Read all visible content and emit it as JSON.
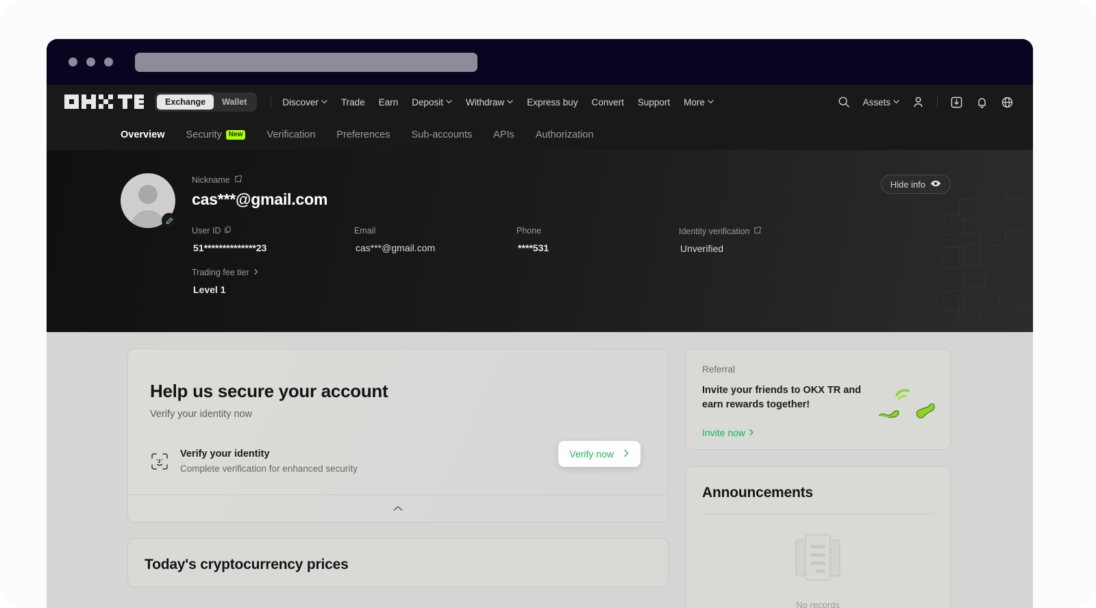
{
  "browser": {
    "address_bar_placeholder": "",
    "traffic_lights": [
      "close-dot",
      "minimize-dot",
      "maximize-dot"
    ]
  },
  "topnav": {
    "logo_text": "OKX TR",
    "segmented": {
      "options": [
        {
          "label": "Exchange",
          "active": true
        },
        {
          "label": "Wallet",
          "active": false
        }
      ]
    },
    "links": [
      {
        "label": "Discover",
        "has_caret": true
      },
      {
        "label": "Trade",
        "has_caret": false
      },
      {
        "label": "Earn",
        "has_caret": false
      },
      {
        "label": "Deposit",
        "has_caret": true
      },
      {
        "label": "Withdraw",
        "has_caret": true
      },
      {
        "label": "Express buy",
        "has_caret": false
      },
      {
        "label": "Convert",
        "has_caret": false
      },
      {
        "label": "Support",
        "has_caret": false
      },
      {
        "label": "More",
        "has_caret": true
      }
    ],
    "right": {
      "search_icon": "search-icon",
      "assets_label": "Assets",
      "profile_icon": "user-icon",
      "download_icon": "download-icon",
      "notification_icon": "bell-icon",
      "language_icon": "globe-icon"
    }
  },
  "subnav": {
    "tabs": [
      {
        "label": "Overview",
        "active": true,
        "badge": ""
      },
      {
        "label": "Security",
        "active": false,
        "badge": "New"
      },
      {
        "label": "Verification",
        "active": false,
        "badge": ""
      },
      {
        "label": "Preferences",
        "active": false,
        "badge": ""
      },
      {
        "label": "Sub-accounts",
        "active": false,
        "badge": ""
      },
      {
        "label": "APIs",
        "active": false,
        "badge": ""
      },
      {
        "label": "Authorization",
        "active": false,
        "badge": ""
      }
    ]
  },
  "hero": {
    "nickname_label": "Nickname",
    "nickname_value": "cas***@gmail.com",
    "hide_info_label": "Hide info",
    "fields": [
      {
        "label": "User ID",
        "value": "51**************23",
        "icon": "copy-icon"
      },
      {
        "label": "Email",
        "value": "cas***@gmail.com",
        "icon": ""
      },
      {
        "label": "Phone",
        "value": "****531",
        "icon": ""
      },
      {
        "label": "Identity verification",
        "value": "Unverified",
        "icon": "external-link-icon"
      }
    ],
    "tier": {
      "label": "Trading fee tier",
      "value": "Level 1"
    }
  },
  "main": {
    "secure_card": {
      "title": "Help us secure your account",
      "subtitle": "Verify your identity now",
      "task": {
        "icon": "face-id-icon",
        "title": "Verify your identity",
        "description": "Complete verification for enhanced security",
        "action_label": "Verify now"
      },
      "collapse_icon": "chevron-up-icon"
    },
    "prices_card": {
      "title": "Today's cryptocurrency prices"
    }
  },
  "sidebar": {
    "referral": {
      "label": "Referral",
      "text": "Invite your friends to OKX TR and earn rewards together!",
      "link_label": "Invite now"
    },
    "announcements": {
      "title": "Announcements",
      "empty_text": "No records",
      "empty_icon": "documents-icon"
    }
  },
  "colors": {
    "accent_green": "#17b45c",
    "badge_green": "#aaff00",
    "nav_bg": "#191919",
    "page_bg": "#d5d6d4",
    "chrome_bg": "#0b0420"
  }
}
